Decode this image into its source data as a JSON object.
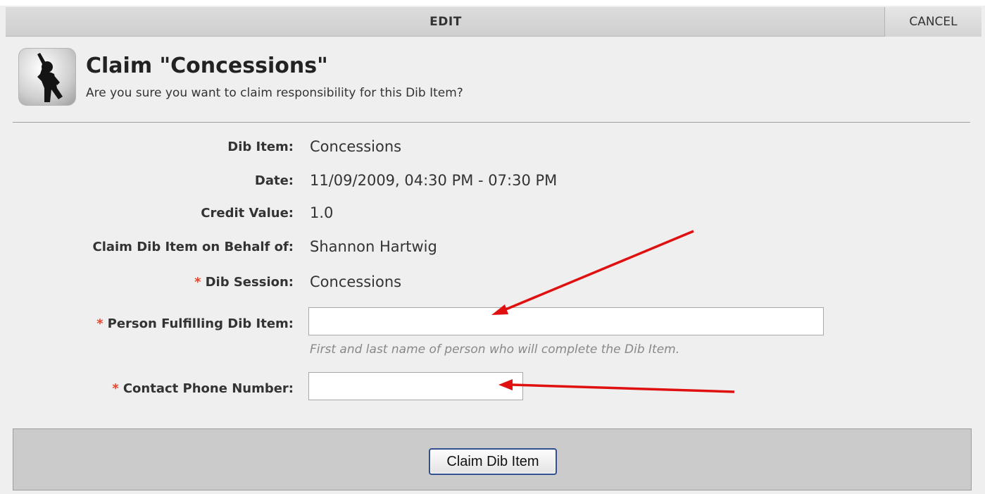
{
  "dialog": {
    "title": "EDIT",
    "cancel_label": "CANCEL"
  },
  "header": {
    "icon": "waving-person-icon",
    "title": "Claim \"Concessions\"",
    "subtitle": "Are you sure you want to claim responsibility for this Dib Item?"
  },
  "fields": {
    "dib_item": {
      "label": "Dib Item:",
      "value": "Concessions"
    },
    "date": {
      "label": "Date:",
      "value": "11/09/2009, 04:30 PM - 07:30 PM"
    },
    "credit_value": {
      "label": "Credit Value:",
      "value": "1.0"
    },
    "behalf_of": {
      "label": "Claim Dib Item on Behalf of:",
      "value": "Shannon Hartwig"
    },
    "dib_session": {
      "required_mark": "*",
      "label": "Dib Session:",
      "value": "Concessions"
    },
    "person_fulfilling": {
      "required_mark": "*",
      "label": "Person Fulfilling Dib Item:",
      "value": "",
      "hint": "First and last name of person who will complete the Dib Item."
    },
    "contact_phone": {
      "required_mark": "*",
      "label": "Contact Phone Number:",
      "value": ""
    }
  },
  "footer": {
    "claim_label": "Claim Dib Item"
  },
  "colors": {
    "required": "#e6452c",
    "annotation_arrow": "#e01010",
    "button_border": "#2f4f8f"
  }
}
